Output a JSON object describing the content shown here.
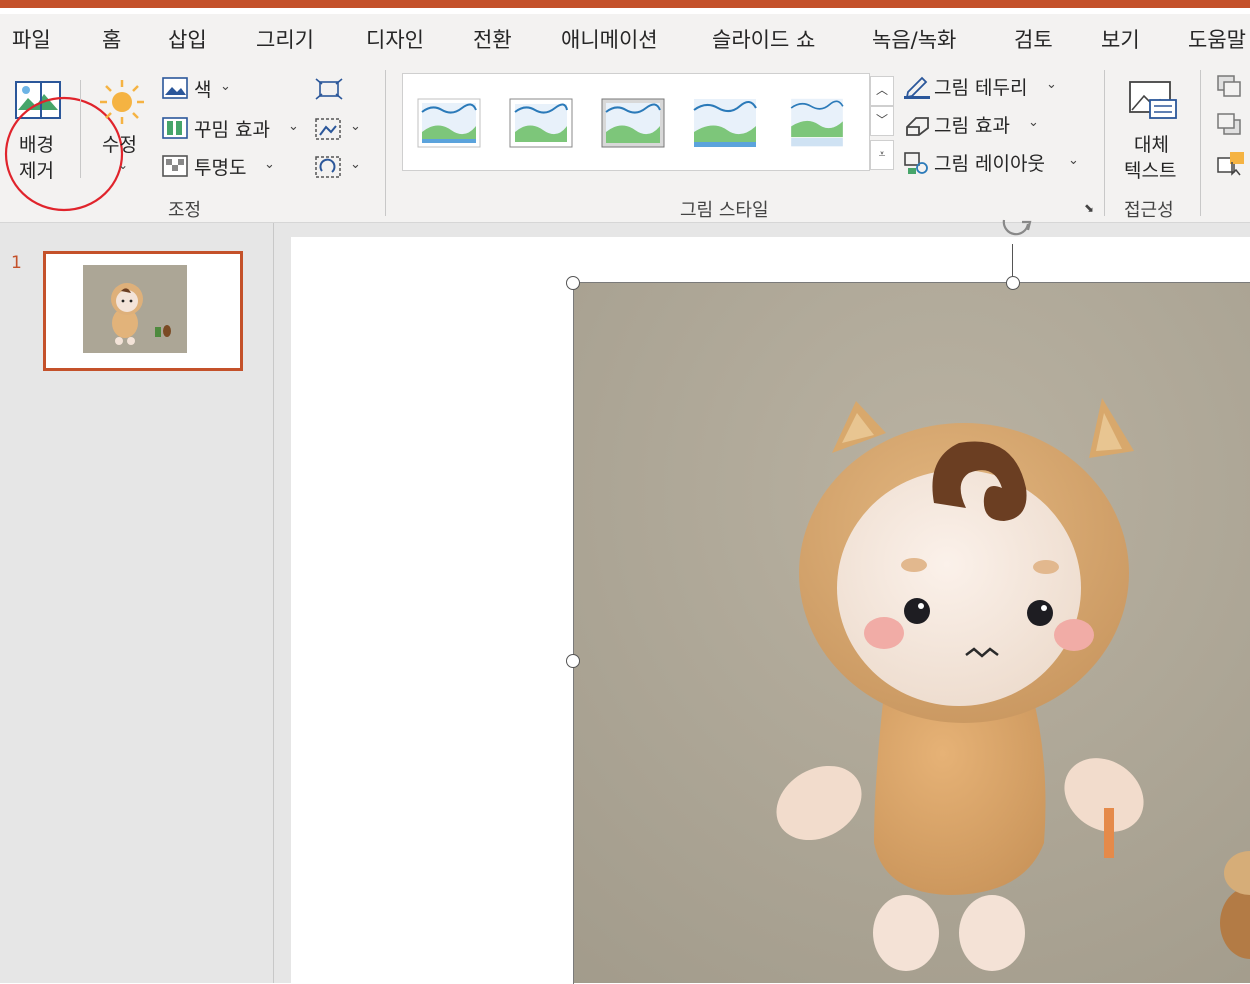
{
  "menu": {
    "items": [
      "파일",
      "홈",
      "삽입",
      "그리기",
      "디자인",
      "전환",
      "애니메이션",
      "슬라이드 쇼",
      "녹음/녹화",
      "검토",
      "보기",
      "도움말"
    ]
  },
  "ribbon": {
    "remove_bg": {
      "line1": "배경",
      "line2": "제거"
    },
    "corrections": {
      "label": "수정"
    },
    "color": {
      "label": "색"
    },
    "artistic": {
      "label": "꾸밈 효과"
    },
    "transparency": {
      "label": "투명도"
    },
    "adjust_group": "조정",
    "picture_border": "그림 테두리",
    "picture_effects": "그림 효과",
    "picture_layout": "그림 레이아웃",
    "styles_group": "그림 스타일",
    "alt_text": {
      "line1": "대체",
      "line2": "텍스트"
    },
    "accessibility_group": "접근성"
  },
  "slides_pane": {
    "slide_number": "1"
  },
  "colors": {
    "accent": "#c4512a",
    "annotation_circle": "#e0242c",
    "ribbon_bg": "#f3f2f1"
  }
}
